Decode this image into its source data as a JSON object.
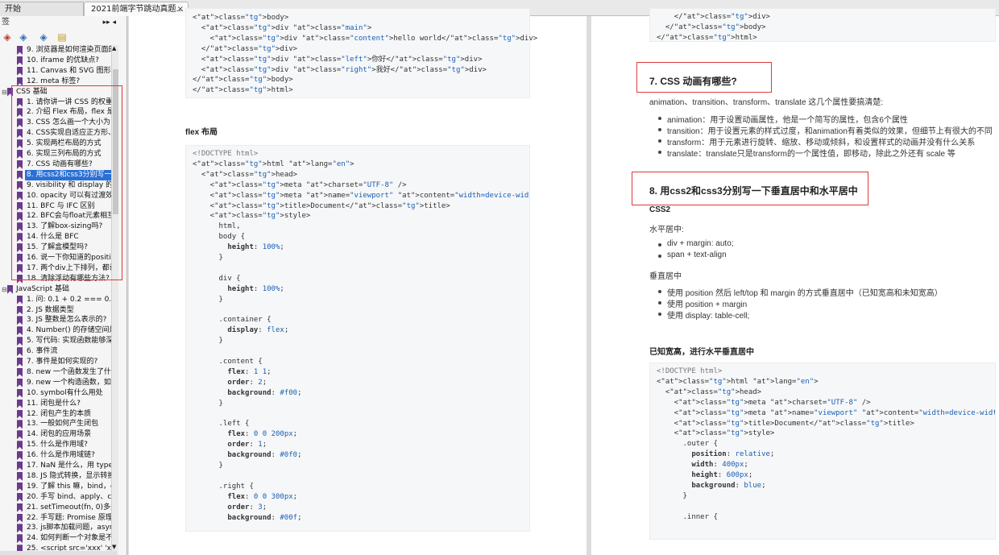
{
  "tabs": {
    "home_label": "开始",
    "doc_label": "2021前端字节跳动真题...",
    "close_glyph": "×"
  },
  "sidebar": {
    "title": "签",
    "controls": "▸▸ ◂",
    "tool_icons": [
      "bookmark-expand-icon",
      "bookmark-add-icon",
      "bookmark-goto-icon",
      "bookmark-page-icon"
    ],
    "items_top": [
      "9. 浏览器是如何渲染页面的",
      "10. iframe 的优缺点?",
      "11. Canvas 和 SVG 图形的",
      "12. meta 标签?"
    ],
    "css_section": "CSS 基础",
    "css_items": [
      "1. 请你讲一讲 CSS 的权重",
      "2. 介绍 Flex 布局，flex 是",
      "3. CSS 怎么画一个大小为",
      "4. CSS实现自适应正方形、",
      "5. 实现两栏布局的方式",
      "6. 实现三列布局的方式",
      "7. CSS 动画有哪些?",
      "8. 用css2和css3分别写一下",
      "9. visibility 和 display 的差",
      "10. opacity 可以有过渡效果",
      "11. BFC 与 IFC 区别",
      "12. BFC会与float元素相互",
      "13. 了解box-sizing吗?",
      "14. 什么是 BFC",
      "15. 了解盒模型吗?",
      "16. 说一下你知道的position",
      "17. 两个div上下排列，都设",
      "18. 清除浮动有哪些方法?"
    ],
    "js_section": "JavaScript 基础",
    "js_items": [
      "1. 问: 0.1 + 0.2 === 0.3",
      "2. JS 数据类型",
      "3. JS 整数是怎么表示的?",
      "4. Number() 的存储空间是",
      "5. 写代码: 实现函数能够深",
      "6. 事件流",
      "7. 事件是如何实现的?",
      "8. new 一个函数发生了什",
      "9. new 一个构造函数，如",
      "10. symbol有什么用处",
      "11. 闭包是什么?",
      "12. 闭包产生的本质",
      "13. 一般如何产生闭包",
      "14. 闭包的应用场景",
      "15. 什么是作用域?",
      "16. 什么是作用域链?",
      "17. NaN 是什么，用 typeo",
      "18. JS 隐式转换，显示转换",
      "19. 了解 this 嘛，bind，ca",
      "20. 手写 bind、apply、call",
      "21. setTimeout(fn, 0)多久",
      "22. 手写题: Promise 原理",
      "23. js脚本加载问题，async",
      "24. 如何判断一个对象是不",
      "25. <script src='xxx' 'xxx'/>"
    ]
  },
  "page1": {
    "code_top": [
      "<body>",
      "  <div class=\"main\">",
      "    <div class=\"content\">hello world</div>",
      "  </div>",
      "  <div class=\"left\">你好</div>",
      "  <div class=\"right\">我好</div>",
      "</body>",
      "</html>"
    ],
    "heading": "flex 布局",
    "code_main": [
      "<!DOCTYPE html>",
      "<html lang=\"en\">",
      "  <head>",
      "    <meta charset=\"UTF-8\" />",
      "    <meta name=\"viewport\" content=\"width=device-width, initial-scale=1.0\" />",
      "    <title>Document</title>",
      "    <style>",
      "      html,",
      "      body {",
      "        height: 100%;",
      "      }",
      "",
      "      div {",
      "        height: 100%;",
      "      }",
      "",
      "      .container {",
      "        display: flex;",
      "      }",
      "",
      "      .content {",
      "        flex: 1 1;",
      "        order: 2;",
      "        background: #f00;",
      "      }",
      "",
      "      .left {",
      "        flex: 0 0 200px;",
      "        order: 1;",
      "        background: #0f0;",
      "      }",
      "",
      "      .right {",
      "        flex: 0 0 300px;",
      "        order: 3;",
      "        background: #00f;"
    ]
  },
  "page2": {
    "code_top": [
      "    </div>",
      "  </body>",
      "</html>"
    ],
    "h7": "7. CSS 动画有哪些?",
    "intro7": "animation、transition、transform、translate 这几个属性要搞清楚:",
    "list7": [
      "animation：用于设置动画属性，他是一个简写的属性，包含6个属性",
      "transition：用于设置元素的样式过度，和animation有着类似的效果，但细节上有很大的不同",
      "transform：用于元素进行旋转、缩放、移动或倾斜，和设置样式的动画并没有什么关系",
      "translate：translate只是transform的一个属性值，即移动，除此之外还有 scale 等"
    ],
    "h8": "8. 用css2和css3分别写一下垂直居中和水平居中",
    "css2": "CSS2",
    "hcenter": "水平居中:",
    "hlist": [
      "div + margin: auto;",
      "span + text-align"
    ],
    "vcenter": "垂直居中",
    "vlist": [
      "使用 position 然后 left/top 和 margin 的方式垂直居中（已知宽高和未知宽高）",
      "使用 position + margin",
      "使用 display: table-cell;"
    ],
    "known": "已知宽高，进行水平垂直居中",
    "code_main": [
      "<!DOCTYPE html>",
      "<html lang=\"en\">",
      "  <head>",
      "    <meta charset=\"UTF-8\" />",
      "    <meta name=\"viewport\" content=\"width=device-width, initial-scale=1.0\" />",
      "    <title>Document</title>",
      "    <style>",
      "      .outer {",
      "        position: relative;",
      "        width: 400px;",
      "        height: 600px;",
      "        background: blue;",
      "      }",
      "",
      "      .inner {"
    ]
  },
  "colors": {
    "selection": "#2a6fd6",
    "highlight_box": "#e03a3a",
    "bookmark": "#6b3a8c"
  }
}
